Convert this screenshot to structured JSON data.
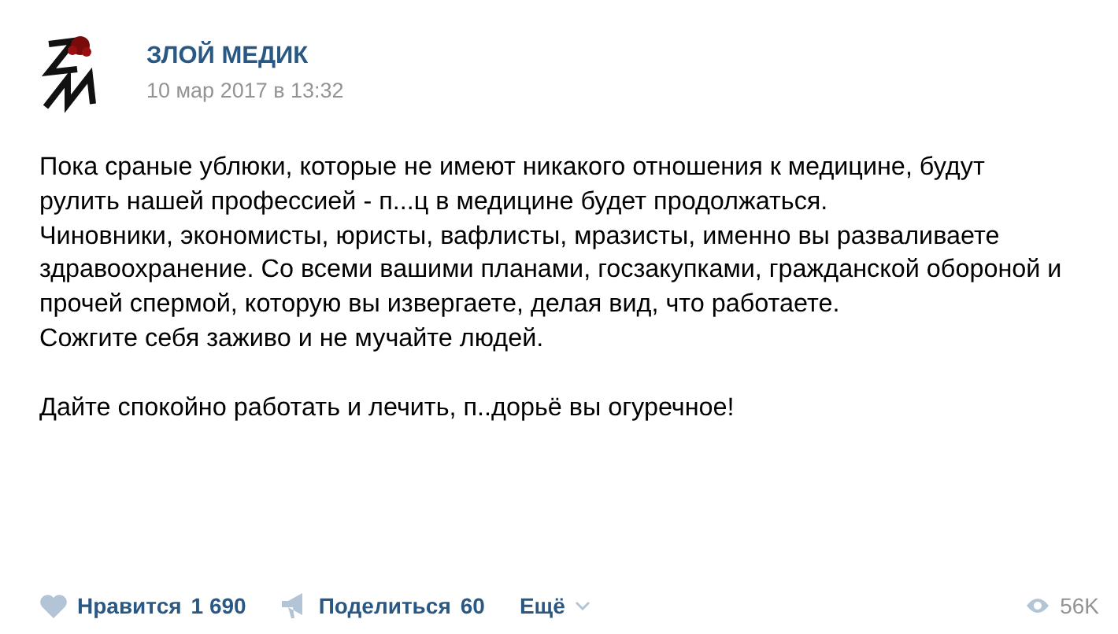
{
  "post": {
    "author": "ЗЛОЙ МЕДИК",
    "date": "10 мар 2017 в 13:32",
    "text_blocks": [
      {
        "paragraphs": [
          "Пока сраные ублюки, которые не имеют никакого отношения к медицине, будут рулить нашей профессией - п...ц в медицине будет продолжаться.",
          "Чиновники, экономисты, юристы, вафлисты, мразисты, именно вы разваливаете здравоохранение. Со всеми вашими планами, госзакупками, гражданской обороной и прочей спермой, которую вы извергаете, делая вид, что работаете.",
          "Сожгите себя заживо и не мучайте людей."
        ]
      },
      {
        "paragraphs": [
          "Дайте спокойно работать и лечить, п..дорьё вы огуречное!"
        ]
      }
    ]
  },
  "footer": {
    "like": {
      "label": "Нравится",
      "count": "1 690"
    },
    "share": {
      "label": "Поделиться",
      "count": "60"
    },
    "more": "Ещё",
    "views": "56K"
  }
}
